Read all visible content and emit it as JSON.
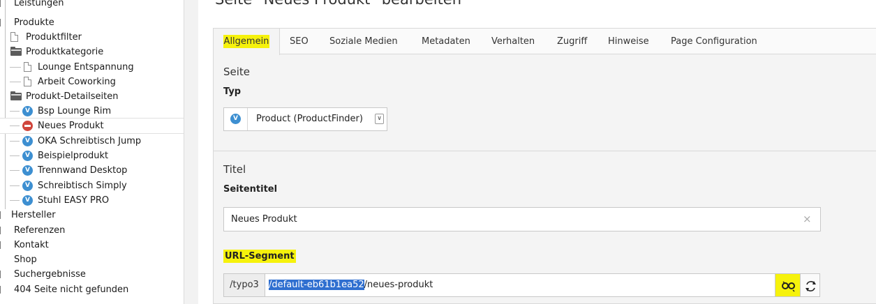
{
  "page_title": "Seite \"Neues Produkt\" bearbeiten",
  "tree": {
    "items": [
      {
        "label": "Leistungen"
      },
      {
        "label": "Produkte"
      },
      {
        "label": "Produktfilter"
      },
      {
        "label": "Produktkategorie"
      },
      {
        "label": "Lounge Entspannung"
      },
      {
        "label": "Arbeit Coworking"
      },
      {
        "label": "Produkt-Detailseiten"
      },
      {
        "label": "Bsp Lounge Rim"
      },
      {
        "label": "Neues Produkt"
      },
      {
        "label": "OKA Schreibtisch Jump"
      },
      {
        "label": "Beispielprodukt"
      },
      {
        "label": "Trennwand Desktop"
      },
      {
        "label": "Schreibtisch Simply"
      },
      {
        "label": "Stuhl EASY PRO"
      },
      {
        "label": "Hersteller"
      },
      {
        "label": "Referenzen"
      },
      {
        "label": "Kontakt"
      },
      {
        "label": "Shop"
      },
      {
        "label": "Suchergebnisse"
      },
      {
        "label": "404 Seite nicht gefunden"
      }
    ]
  },
  "tabs": [
    {
      "label": "Allgemein"
    },
    {
      "label": "SEO"
    },
    {
      "label": "Soziale Medien"
    },
    {
      "label": "Metadaten"
    },
    {
      "label": "Verhalten"
    },
    {
      "label": "Zugriff"
    },
    {
      "label": "Hinweise"
    },
    {
      "label": "Page Configuration"
    }
  ],
  "sections": {
    "seite": {
      "title": "Seite",
      "typ_label": "Typ",
      "typ_value": "Product (ProductFinder)"
    },
    "titel": {
      "title": "Titel",
      "seitentitel_label": "Seitentitel",
      "seitentitel_value": "Neues Produkt",
      "clear_symbol": "×"
    },
    "url": {
      "label": "URL-Segment",
      "prefix": "/typo3",
      "slug_selected": "/default-eb61b1ea52",
      "slug_rest": "/neues-produkt"
    }
  },
  "colors": {
    "highlight": "#f6f20c",
    "selection": "#2f6fd0",
    "doktype_icon": "#3d8fd1",
    "hidden_icon": "#d0463c"
  },
  "icons": {
    "toggle": "unlink-icon",
    "refresh": "refresh-icon"
  }
}
